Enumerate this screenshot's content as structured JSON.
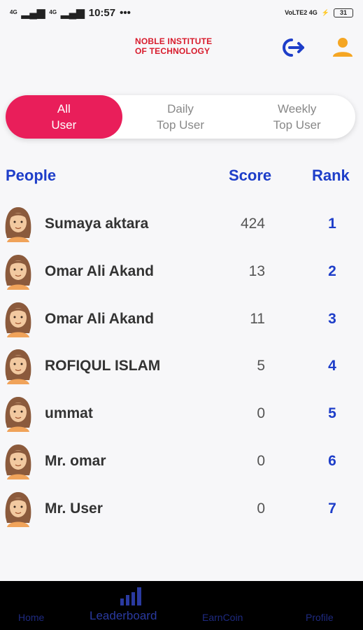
{
  "status": {
    "time": "10:57",
    "dots": "•••",
    "signal_left_1": "4G",
    "signal_left_2": "4G",
    "network_right": "VoLTE2 4G",
    "battery": "31"
  },
  "header": {
    "brand_line1": "NOBLE INSTITUTE",
    "brand_line2": "OF TECHNOLOGY",
    "logout_icon": "logout-icon",
    "profile_icon": "user-icon"
  },
  "tabs": [
    {
      "label": "All\nUser",
      "active": true
    },
    {
      "label": "Daily\nTop User",
      "active": false
    },
    {
      "label": "Weekly\nTop User",
      "active": false
    }
  ],
  "columns": {
    "people": "People",
    "score": "Score",
    "rank": "Rank"
  },
  "leaderboard": [
    {
      "name": "Sumaya aktara",
      "score": "424",
      "rank": "1"
    },
    {
      "name": "Omar Ali Akand",
      "score": "13",
      "rank": "2"
    },
    {
      "name": "Omar Ali Akand",
      "score": "11",
      "rank": "3"
    },
    {
      "name": "ROFIQUL ISLAM",
      "score": "5",
      "rank": "4"
    },
    {
      "name": "ummat",
      "score": "0",
      "rank": "5"
    },
    {
      "name": "Mr. omar",
      "score": "0",
      "rank": "6"
    },
    {
      "name": "Mr. User",
      "score": "0",
      "rank": "7"
    }
  ],
  "nav": {
    "home": "Home",
    "leaderboard": "Leaderboard",
    "earncoin": "EarnCoin",
    "profile": "Profile",
    "active": "leaderboard"
  },
  "colors": {
    "accent": "#e91e5a",
    "primary_blue": "#1e3ec9",
    "brand_red": "#d81b2c",
    "profile_orange": "#f5a623"
  }
}
